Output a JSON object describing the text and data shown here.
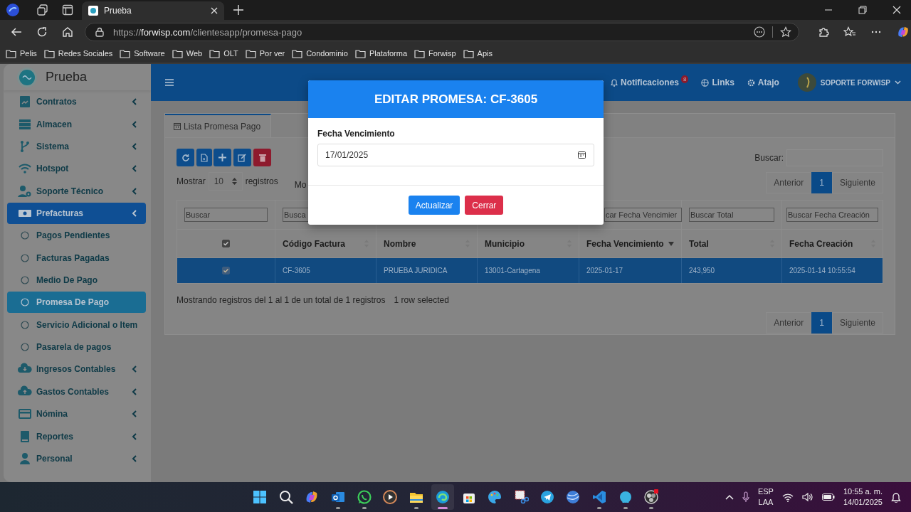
{
  "browser": {
    "tab": {
      "title": "Prueba"
    },
    "url": "https://**forwisp.com**/clientesapp/promesa-pago",
    "bookmarks": [
      "Pelis",
      "Redes Sociales",
      "Software",
      "Web",
      "OLT",
      "Por ver",
      "Condominio",
      "Plataforma",
      "Forwisp",
      "Apis"
    ]
  },
  "sidebar": {
    "brand": "Prueba",
    "items": [
      {
        "label": "Contratos",
        "selected": false
      },
      {
        "label": "Almacen",
        "selected": false
      },
      {
        "label": "Sistema",
        "selected": false
      },
      {
        "label": "Hotspot",
        "selected": false
      },
      {
        "label": "Soporte Técnico",
        "selected": false
      },
      {
        "label": "Prefacturas",
        "selected": true,
        "children": [
          {
            "label": "Pagos Pendientes",
            "selected": false
          },
          {
            "label": "Facturas Pagadas",
            "selected": false
          },
          {
            "label": "Medio De Pago",
            "selected": false
          },
          {
            "label": "Promesa De Pago",
            "selected": true
          },
          {
            "label": "Servicio Adicional o Item",
            "selected": false
          },
          {
            "label": "Pasarela de pagos",
            "selected": false
          }
        ]
      },
      {
        "label": "Ingresos Contables",
        "selected": false
      },
      {
        "label": "Gastos Contables",
        "selected": false
      },
      {
        "label": "Nómina",
        "selected": false
      },
      {
        "label": "Reportes",
        "selected": false
      },
      {
        "label": "Personal",
        "selected": false
      }
    ]
  },
  "navbar": {
    "notifications": {
      "label": "Notificaciones",
      "badge": "8"
    },
    "links": "Links",
    "shortcut": "Atajo",
    "user": "SOPORTE FORWISP"
  },
  "card": {
    "tab": "Lista Promesa Pago",
    "show_label": "Mostrar",
    "page_size": "10",
    "show_suffix": "registros",
    "columns_button": "Mo",
    "search_label": "Buscar:",
    "pagination_top": [
      {
        "label": "Anterior",
        "selected": false
      },
      {
        "label": "1",
        "selected": true
      },
      {
        "label": "Siguiente",
        "selected": false
      }
    ],
    "info": "Mostrando registros del 1 al 1 de un total de 1 registros",
    "selection_info": "1 row selected",
    "pagination_bottom": [
      {
        "label": "Anterior",
        "selected": false
      },
      {
        "label": "1",
        "selected": true
      },
      {
        "label": "Siguiente",
        "selected": false
      }
    ]
  },
  "table": {
    "select_column": {
      "checked": true,
      "placeholder": "Buscar"
    },
    "columns": [
      {
        "label": "Código Factura",
        "placeholder": "Busca",
        "sorted": false
      },
      {
        "label": "Nombre",
        "sorted": false
      },
      {
        "label": "Municipio",
        "sorted": false
      },
      {
        "label": "Fecha Vencimiento",
        "placeholder": "car Fecha Vencimier",
        "sorted": true
      },
      {
        "label": "Total",
        "placeholder": "Buscar Total",
        "sorted": false
      },
      {
        "label": "Fecha Creación",
        "placeholder": "Buscar Fecha Creación",
        "sorted": false
      }
    ],
    "rows": [
      {
        "selected": true,
        "checked": true,
        "cells": [
          "CF-3605",
          "PRUEBA JURIDICA",
          "13001-Cartagena",
          "2025-01-17",
          "243,950",
          "2025-01-14 10:55:54"
        ]
      }
    ]
  },
  "modal": {
    "title": "EDITAR PROMESA: CF-3605",
    "field_label": "Fecha Vencimiento",
    "date_value": "17/01/2025",
    "buttons": [
      {
        "label": "Actualizar",
        "kind": "primary"
      },
      {
        "label": "Cerrar",
        "kind": "danger"
      }
    ]
  },
  "taskbar": {
    "apps": [
      {
        "running": false,
        "selected": false
      },
      {
        "running": false,
        "selected": false
      },
      {
        "running": false,
        "selected": false
      },
      {
        "running": true,
        "selected": false
      },
      {
        "running": true,
        "selected": false
      },
      {
        "running": false,
        "selected": false
      },
      {
        "running": true,
        "selected": false
      },
      {
        "running": true,
        "selected": true
      },
      {
        "running": false,
        "selected": false
      },
      {
        "running": false,
        "selected": false
      },
      {
        "running": false,
        "selected": false
      },
      {
        "running": false,
        "selected": false
      },
      {
        "running": false,
        "selected": false
      },
      {
        "running": true,
        "selected": false
      },
      {
        "running": true,
        "selected": false
      },
      {
        "running": true,
        "selected": false
      }
    ],
    "language": "ESP",
    "layout": "LAA",
    "time": "10:55 a. m.",
    "date": "14/01/2025"
  }
}
